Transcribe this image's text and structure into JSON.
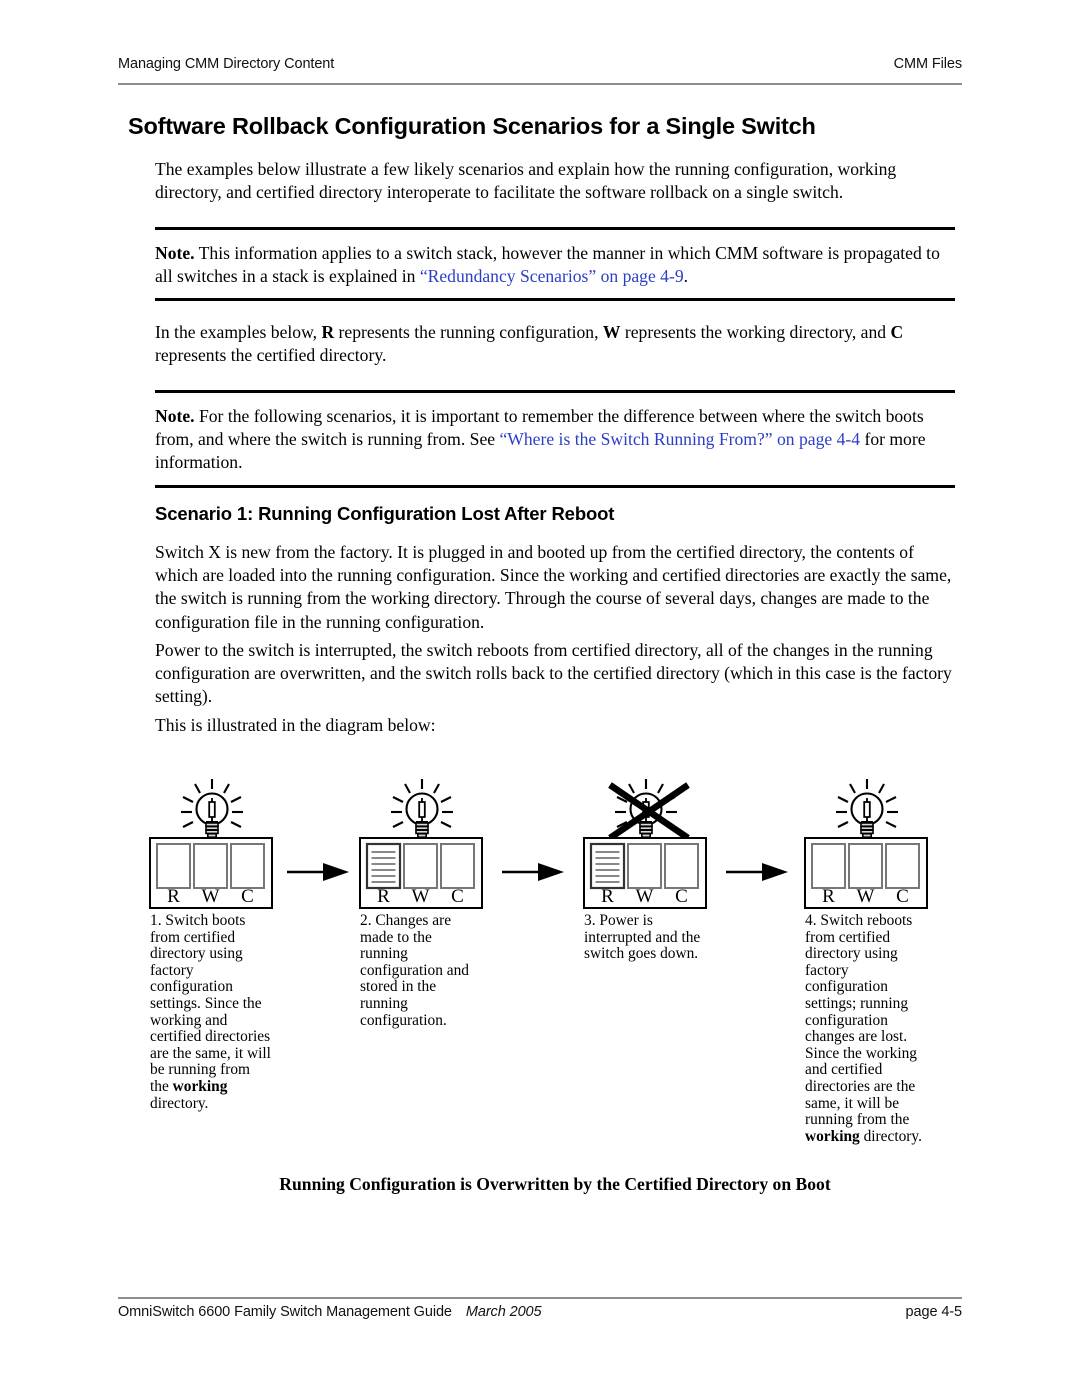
{
  "header": {
    "left": "Managing CMM Directory Content",
    "right": "CMM Files"
  },
  "title": "Software Rollback Configuration Scenarios for a Single Switch",
  "intro_paragraph": "The examples below illustrate a few likely scenarios and explain how the running configuration, working directory, and certified directory interoperate to facilitate the software rollback on a single switch.",
  "note1": {
    "label": "Note.",
    "text_before": " This information applies to a switch stack, however the manner in which CMM software is propagated to all switches in a stack is explained in ",
    "link": "“Redundancy Scenarios” on page 4-9",
    "text_after": "."
  },
  "legend_paragraph": {
    "p1": "In the examples below, ",
    "b1": "R",
    "p2": " represents the running configuration, ",
    "b2": "W",
    "p3": " represents the working directory, and ",
    "b3": "C",
    "p4": " represents the certified directory."
  },
  "note2": {
    "label": "Note.",
    "text_before": " For the following scenarios, it is important to remember the difference between where the switch boots from, and where the switch is running from. See ",
    "link": "“Where is the Switch Running From?” on page 4-4",
    "text_after": " for more information."
  },
  "scenario_heading": "Scenario 1: Running Configuration Lost After Reboot",
  "scenario_paragraphs": [
    "Switch X is new from the factory. It is plugged in and booted up from the certified directory, the contents of which are loaded into the running configuration. Since the working and certified directories are exactly the same, the switch is running from the working directory. Through the course of several days, changes are made to the configuration file in the running configuration.",
    "Power to the switch is interrupted, the switch reboots from certified directory, all of the changes in the running configuration are overwritten, and the switch rolls back to the certified directory (which in this case is the factory setting).",
    "This is illustrated in the diagram below:"
  ],
  "diagram": {
    "box_labels": [
      "R",
      "W",
      "C"
    ],
    "panels": [
      {
        "step": "1",
        "bulb": "on",
        "filled_boxes": [],
        "caption_prefix": "1. Switch boots from certified directory using factory configuration settings. Since the working and certified directories are the same, it will be running from the ",
        "caption_bold": "working",
        "caption_suffix": " directory."
      },
      {
        "step": "2",
        "bulb": "on",
        "filled_boxes": [
          "R"
        ],
        "caption_prefix": "2. Changes are made to the running configuration and stored in the running configuration.",
        "caption_bold": "",
        "caption_suffix": ""
      },
      {
        "step": "3",
        "bulb": "off",
        "filled_boxes": [
          "R"
        ],
        "caption_prefix": "3. Power is interrupted and the switch goes down.",
        "caption_bold": "",
        "caption_suffix": ""
      },
      {
        "step": "4",
        "bulb": "on",
        "filled_boxes": [],
        "caption_prefix": "4. Switch reboots from certified directory using factory configuration settings; running configuration changes are lost. Since the working and certified directories are the same, it will be running from the ",
        "caption_bold": "working",
        "caption_suffix": " directory."
      }
    ],
    "figure_caption": "Running Configuration is Overwritten by the Certified Directory on Boot"
  },
  "footer": {
    "guide": "OmniSwitch 6600 Family Switch Management Guide",
    "date": "March 2005",
    "page": "page 4-5"
  },
  "colors": {
    "link": "#2b3ec9",
    "rule": "#8d8d8d",
    "text": "#000000"
  }
}
